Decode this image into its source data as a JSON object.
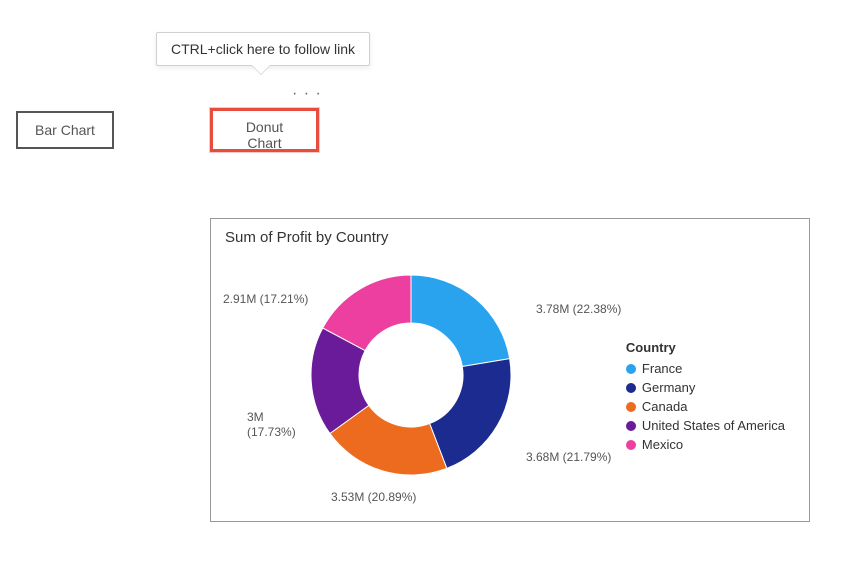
{
  "tooltip": {
    "text": "CTRL+click here to follow link"
  },
  "buttons": {
    "bar_label": "Bar Chart",
    "donut_label": "Donut Chart"
  },
  "ellipsis": "· · ·",
  "chart": {
    "title": "Sum of Profit by Country",
    "legend_title": "Country"
  },
  "colors": {
    "france": "#2aa3ef",
    "germany": "#1c2b8f",
    "canada": "#ec6b1f",
    "usa": "#6a1b9a",
    "mexico": "#ec3fa0"
  },
  "chart_data": {
    "type": "pie",
    "title": "Sum of Profit by Country",
    "series": [
      {
        "name": "France",
        "value": 3.78,
        "percent": 22.38,
        "label": "3.78M (22.38%)",
        "color": "#2aa3ef"
      },
      {
        "name": "Germany",
        "value": 3.68,
        "percent": 21.79,
        "label": "3.68M (21.79%)",
        "color": "#1c2b8f"
      },
      {
        "name": "Canada",
        "value": 3.53,
        "percent": 20.89,
        "label": "3.53M (20.89%)",
        "color": "#ec6b1f"
      },
      {
        "name": "United States of America",
        "value": 3.0,
        "percent": 17.73,
        "label": "3M\n(17.73%)",
        "color": "#6a1b9a"
      },
      {
        "name": "Mexico",
        "value": 2.91,
        "percent": 17.21,
        "label": "2.91M (17.21%)",
        "color": "#ec3fa0"
      }
    ],
    "units": "M",
    "inner_radius_ratio": 0.52,
    "legend_position": "right"
  }
}
